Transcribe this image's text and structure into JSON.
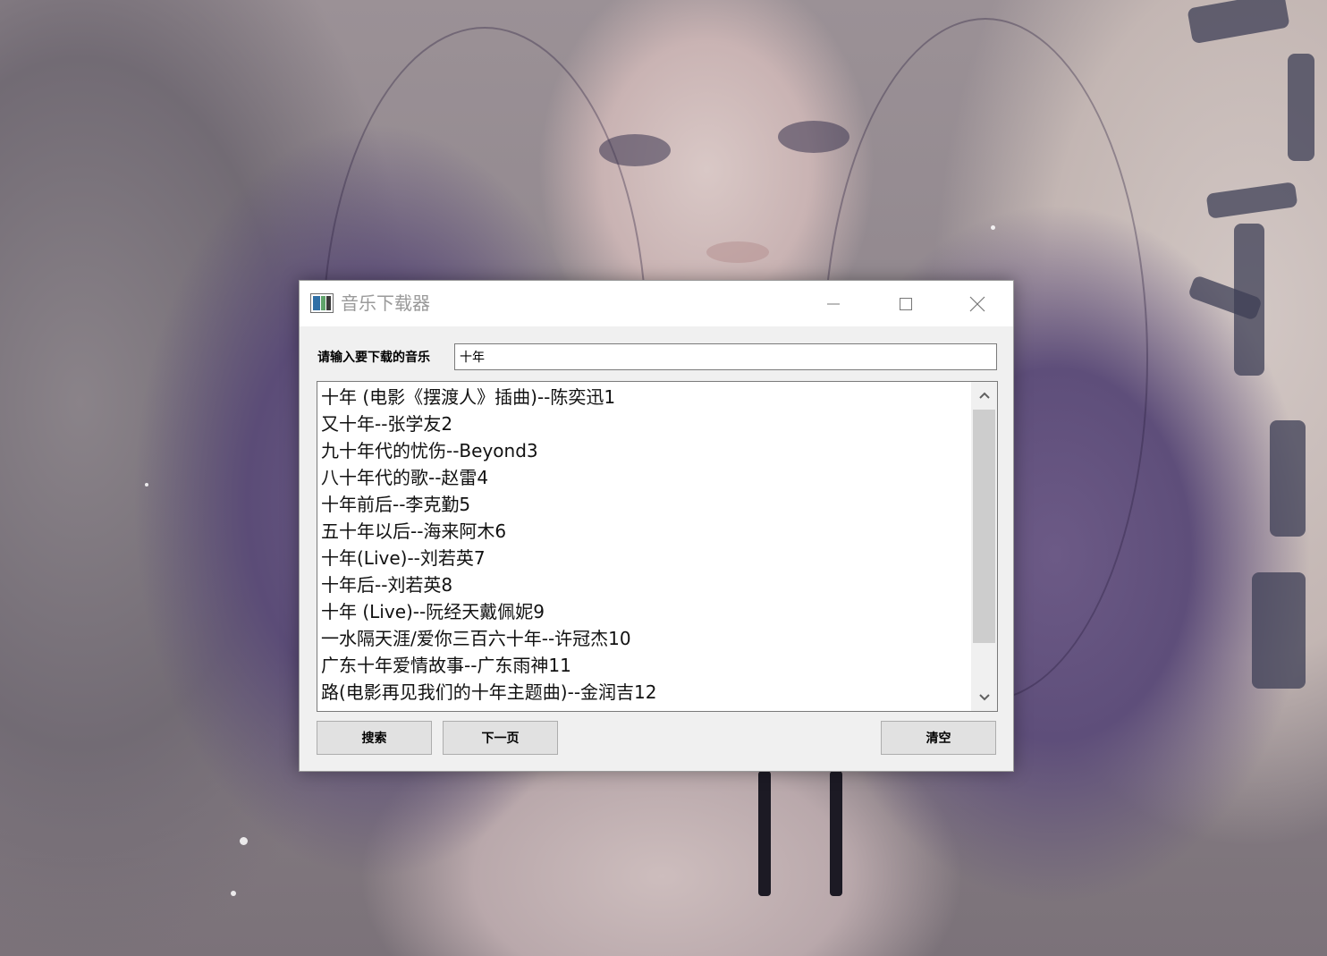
{
  "window": {
    "title": "音乐下载器",
    "controls": {
      "minimize_icon": "minimize-icon",
      "maximize_icon": "maximize-icon",
      "close_icon": "close-icon"
    }
  },
  "search": {
    "label": "请输入要下载的音乐",
    "value": "十年"
  },
  "results": {
    "items": [
      "十年 (电影《摆渡人》插曲)--陈奕迅1",
      "又十年--张学友2",
      "九十年代的忧伤--Beyond3",
      "八十年代的歌--赵雷4",
      "十年前后--李克勤5",
      "五十年以后--海来阿木6",
      "十年(Live)--刘若英7",
      "十年后--刘若英8",
      "十年 (Live)--阮经天戴佩妮9",
      "一水隔天涯/爱你三百六十年--许冠杰10",
      "广东十年爱情故事--广东雨神11",
      "路(电影再见我们的十年主题曲)--金润吉12"
    ],
    "scrollbar": {
      "up_icon": "chevron-up-icon",
      "down_icon": "chevron-down-icon"
    }
  },
  "buttons": {
    "search": "搜索",
    "next_page": "下一页",
    "clear": "清空"
  },
  "colors": {
    "window_bg": "#f0f0f0",
    "titlebar_bg": "#ffffff",
    "title_text": "#9a9a9a",
    "button_bg": "#e1e1e1",
    "scroll_thumb": "#cdcdcd"
  }
}
